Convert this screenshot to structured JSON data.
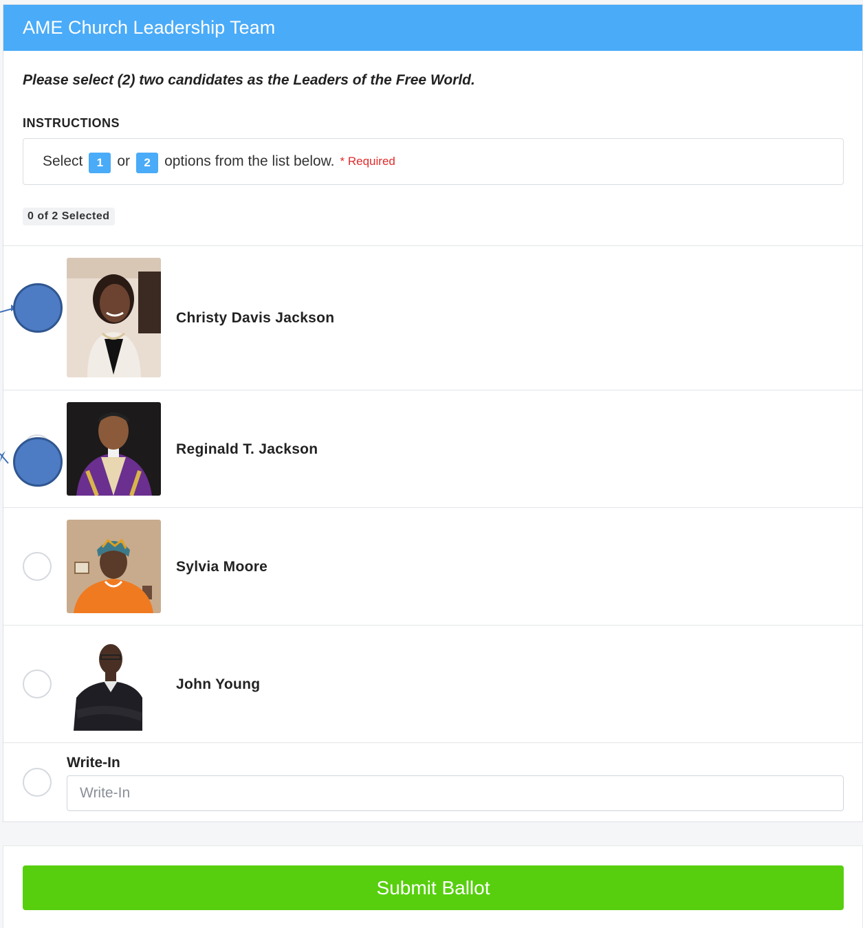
{
  "header": {
    "title": "AME Church Leadership Team"
  },
  "prompt": "Please select (2) two candidates as the Leaders of the Free World.",
  "instructions": {
    "title": "INSTRUCTIONS",
    "prefix": "Select",
    "min": "1",
    "joiner": "or",
    "max": "2",
    "suffix": "options from the list below.",
    "required": "* Required"
  },
  "selection_count": "0 of 2 Selected",
  "candidates": [
    {
      "name": "Christy Davis Jackson",
      "photo_icon": "portrait-woman-icon"
    },
    {
      "name": "Reginald T. Jackson",
      "photo_icon": "portrait-man-robe-icon"
    },
    {
      "name": "Sylvia Moore",
      "photo_icon": "portrait-woman-orange-icon"
    },
    {
      "name": "John Young",
      "photo_icon": "portrait-man-sweater-icon"
    }
  ],
  "write_in": {
    "label": "Write-In",
    "placeholder": "Write-In",
    "value": ""
  },
  "submit": {
    "label": "Submit Ballot"
  },
  "colors": {
    "header": "#4aabf8",
    "submit": "#57cf0e",
    "required": "#e02a2a",
    "marker": "#4d7bc4"
  }
}
